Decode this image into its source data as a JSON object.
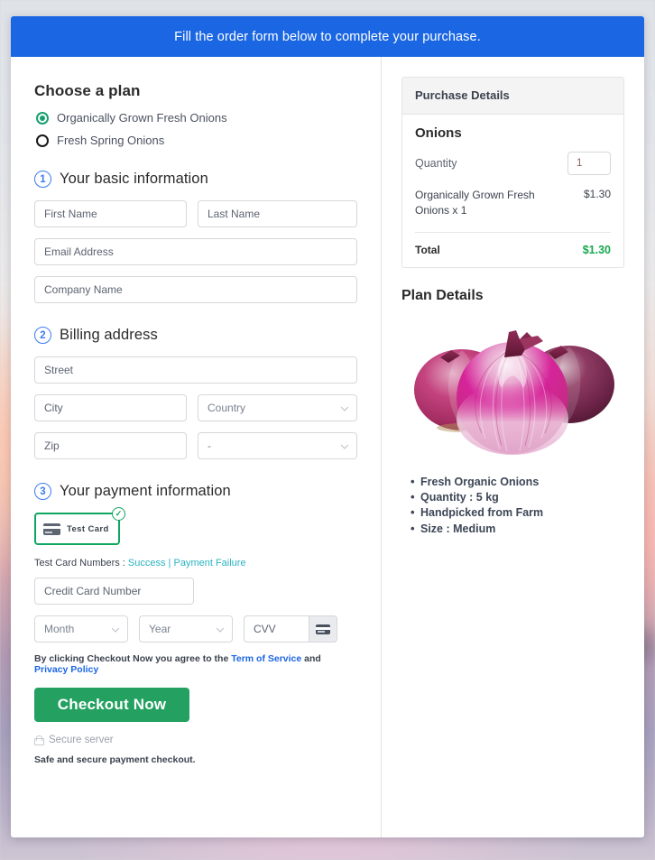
{
  "banner": {
    "text": "Fill the order form below to complete your purchase."
  },
  "plan": {
    "heading": "Choose a plan",
    "options": [
      {
        "label": "Organically Grown Fresh Onions",
        "selected": true
      },
      {
        "label": "Fresh Spring Onions",
        "selected": false
      }
    ]
  },
  "steps": {
    "basic": {
      "number": "1",
      "label": "Your basic information"
    },
    "billing": {
      "number": "2",
      "label": "Billing address"
    },
    "payment": {
      "number": "3",
      "label": "Your payment information"
    }
  },
  "fields": {
    "first_name": "First Name",
    "last_name": "Last Name",
    "email": "Email Address",
    "company": "Company Name",
    "street": "Street",
    "city": "City",
    "country": "Country",
    "zip": "Zip",
    "state": "-",
    "credit_card": "Credit Card Number",
    "month": "Month",
    "year": "Year",
    "cvv": "CVV"
  },
  "payment": {
    "method_label": "Test  Card",
    "method_selected": true,
    "check_glyph": "✓",
    "test_prefix": "Test Card Numbers : ",
    "test_success": "Success",
    "test_separator": " | ",
    "test_failure": "Payment Failure"
  },
  "agreement": {
    "prefix": "By clicking Checkout Now you agree to the ",
    "tos": "Term of Service",
    "middle": " and ",
    "privacy": "Privacy Policy"
  },
  "checkout": {
    "button_label": "Checkout Now",
    "secure_label": "Secure server",
    "safe_note": "Safe and secure payment checkout."
  },
  "purchase_details": {
    "title": "Purchase Details",
    "product": "Onions",
    "quantity_label": "Quantity",
    "quantity_value": "1",
    "line_item_name": "Organically Grown Fresh Onions x 1",
    "line_item_price": "$1.30",
    "total_label": "Total",
    "total_value": "$1.30"
  },
  "plan_details": {
    "title": "Plan Details",
    "image_alt": "red-onions-photo",
    "bullets": [
      "Fresh Organic Onions",
      "Quantity : 5 kg",
      "Handpicked from Farm",
      "Size : Medium"
    ]
  },
  "colors": {
    "banner_blue": "#1a66e3",
    "accent_green": "#24a161",
    "total_green": "#17a84f",
    "link_teal": "#2bb3c0",
    "link_blue": "#1a66e3",
    "step_blue": "#3a7bf0"
  }
}
